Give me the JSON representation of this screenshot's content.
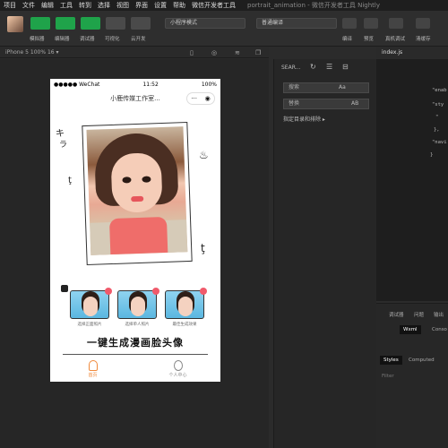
{
  "menu": {
    "items": [
      "项目",
      "文件",
      "编辑",
      "工具",
      "转到",
      "选择",
      "视图",
      "界面",
      "设置",
      "帮助",
      "微信开发者工具"
    ],
    "window_title": "portrait_animation - 微信开发者工具 Nightly"
  },
  "toolbar": {
    "left_labels": [
      "模拟器",
      "编辑器",
      "调试器",
      "可视化",
      "云开发"
    ],
    "mode_select": "小程序模式",
    "compile_select": "普通编译",
    "right_labels": [
      "编译",
      "预览",
      "真机调试",
      "清缓存"
    ]
  },
  "simulator": {
    "device": "iPhone 5 100% 16 ▾",
    "phone": {
      "carrier": "●●●●● WeChat",
      "time": "11:52",
      "battery": "100%",
      "nav_title": "小鹿传媒工作室...",
      "thumbs": [
        {
          "label": "选择正面照片"
        },
        {
          "label": "选择单人照片"
        },
        {
          "label": "最佳生成效果"
        }
      ],
      "headline": "一键生成漫画脸头像",
      "tabs": [
        {
          "label": "首页"
        },
        {
          "label": "个人中心"
        }
      ]
    }
  },
  "midpanel": {
    "header": "SEAR...",
    "search_placeholder": "搜索",
    "search_flag": "Aa",
    "replace_placeholder": "替换",
    "replace_flag": "AB",
    "toggle": "指定目录和排除 ▸"
  },
  "editor": {
    "file": "index.js",
    "lines": [
      "\"enab",
      "\"sty",
      "\"",
      "},",
      "\"navi",
      "}"
    ]
  },
  "debugger": {
    "tabs": [
      "调试器",
      "问题",
      "输出"
    ],
    "subtabs": [
      "Wxml",
      "Conso"
    ],
    "style_tabs": [
      "Styles",
      "Computed"
    ],
    "filter": "Filter"
  },
  "colors": {
    "accent_green": "#1fa34a",
    "tab_active": "#f08a3c",
    "badge": "#f05a6b"
  }
}
